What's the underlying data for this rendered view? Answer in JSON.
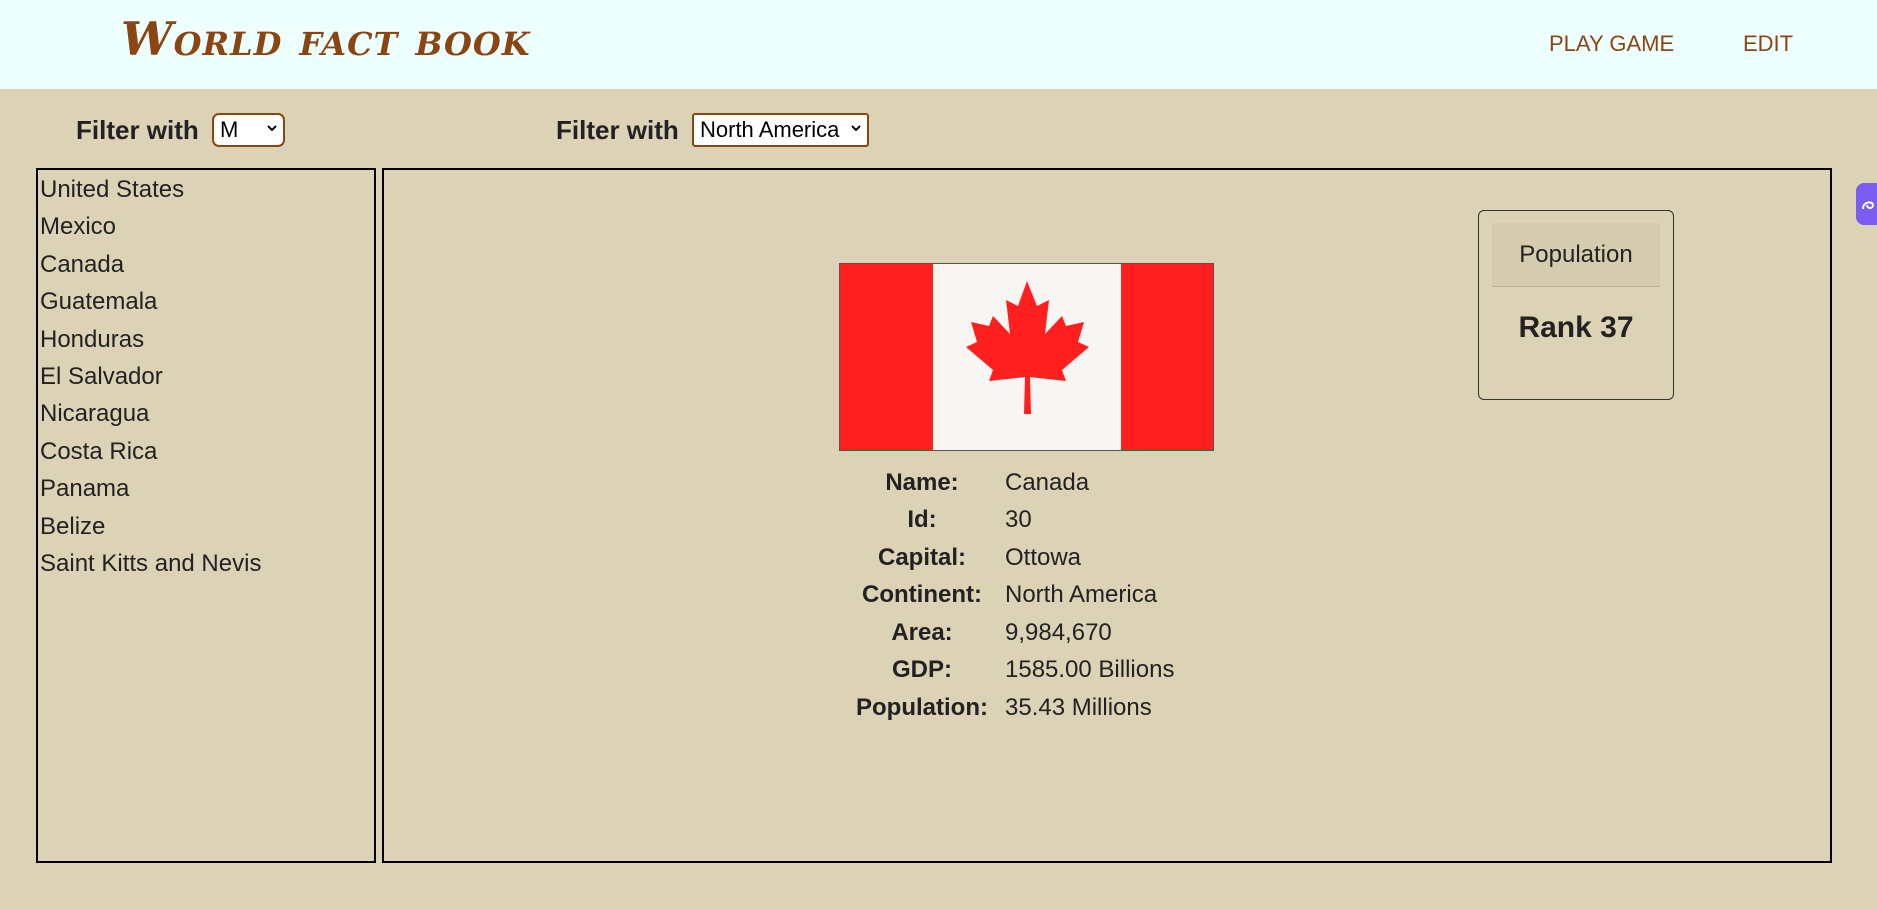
{
  "header": {
    "logo": "World fact book",
    "nav": {
      "play_game": "PLAY GAME",
      "edit": "EDIT"
    }
  },
  "filters": {
    "letter": {
      "label": "Filter with",
      "selected": "M"
    },
    "continent": {
      "label": "Filter with",
      "selected": "North America"
    }
  },
  "countries": [
    "United States",
    "Mexico",
    "Canada",
    "Guatemala",
    "Honduras",
    "El Salvador",
    "Nicaragua",
    "Costa Rica",
    "Panama",
    "Belize",
    "Saint Kitts and Nevis"
  ],
  "detail": {
    "flag_icon": "canada-flag",
    "fields": [
      {
        "label": "Name:",
        "value": "Canada"
      },
      {
        "label": "Id:",
        "value": "30"
      },
      {
        "label": "Capital:",
        "value": "Ottowa"
      },
      {
        "label": "Continent:",
        "value": "North America"
      },
      {
        "label": "Area:",
        "value": "9,984,670"
      },
      {
        "label": "GDP:",
        "value": "1585.00 Billions"
      },
      {
        "label": "Population:",
        "value": "35.43 Millions"
      }
    ]
  },
  "rank_card": {
    "title": "Population",
    "rank": "Rank 37"
  },
  "colors": {
    "brand": "#8b4513",
    "background": "#dcd2b6",
    "header_bg": "#eeffff",
    "flag_red": "#ff1f1f",
    "side_tab": "#7b5cf0"
  }
}
